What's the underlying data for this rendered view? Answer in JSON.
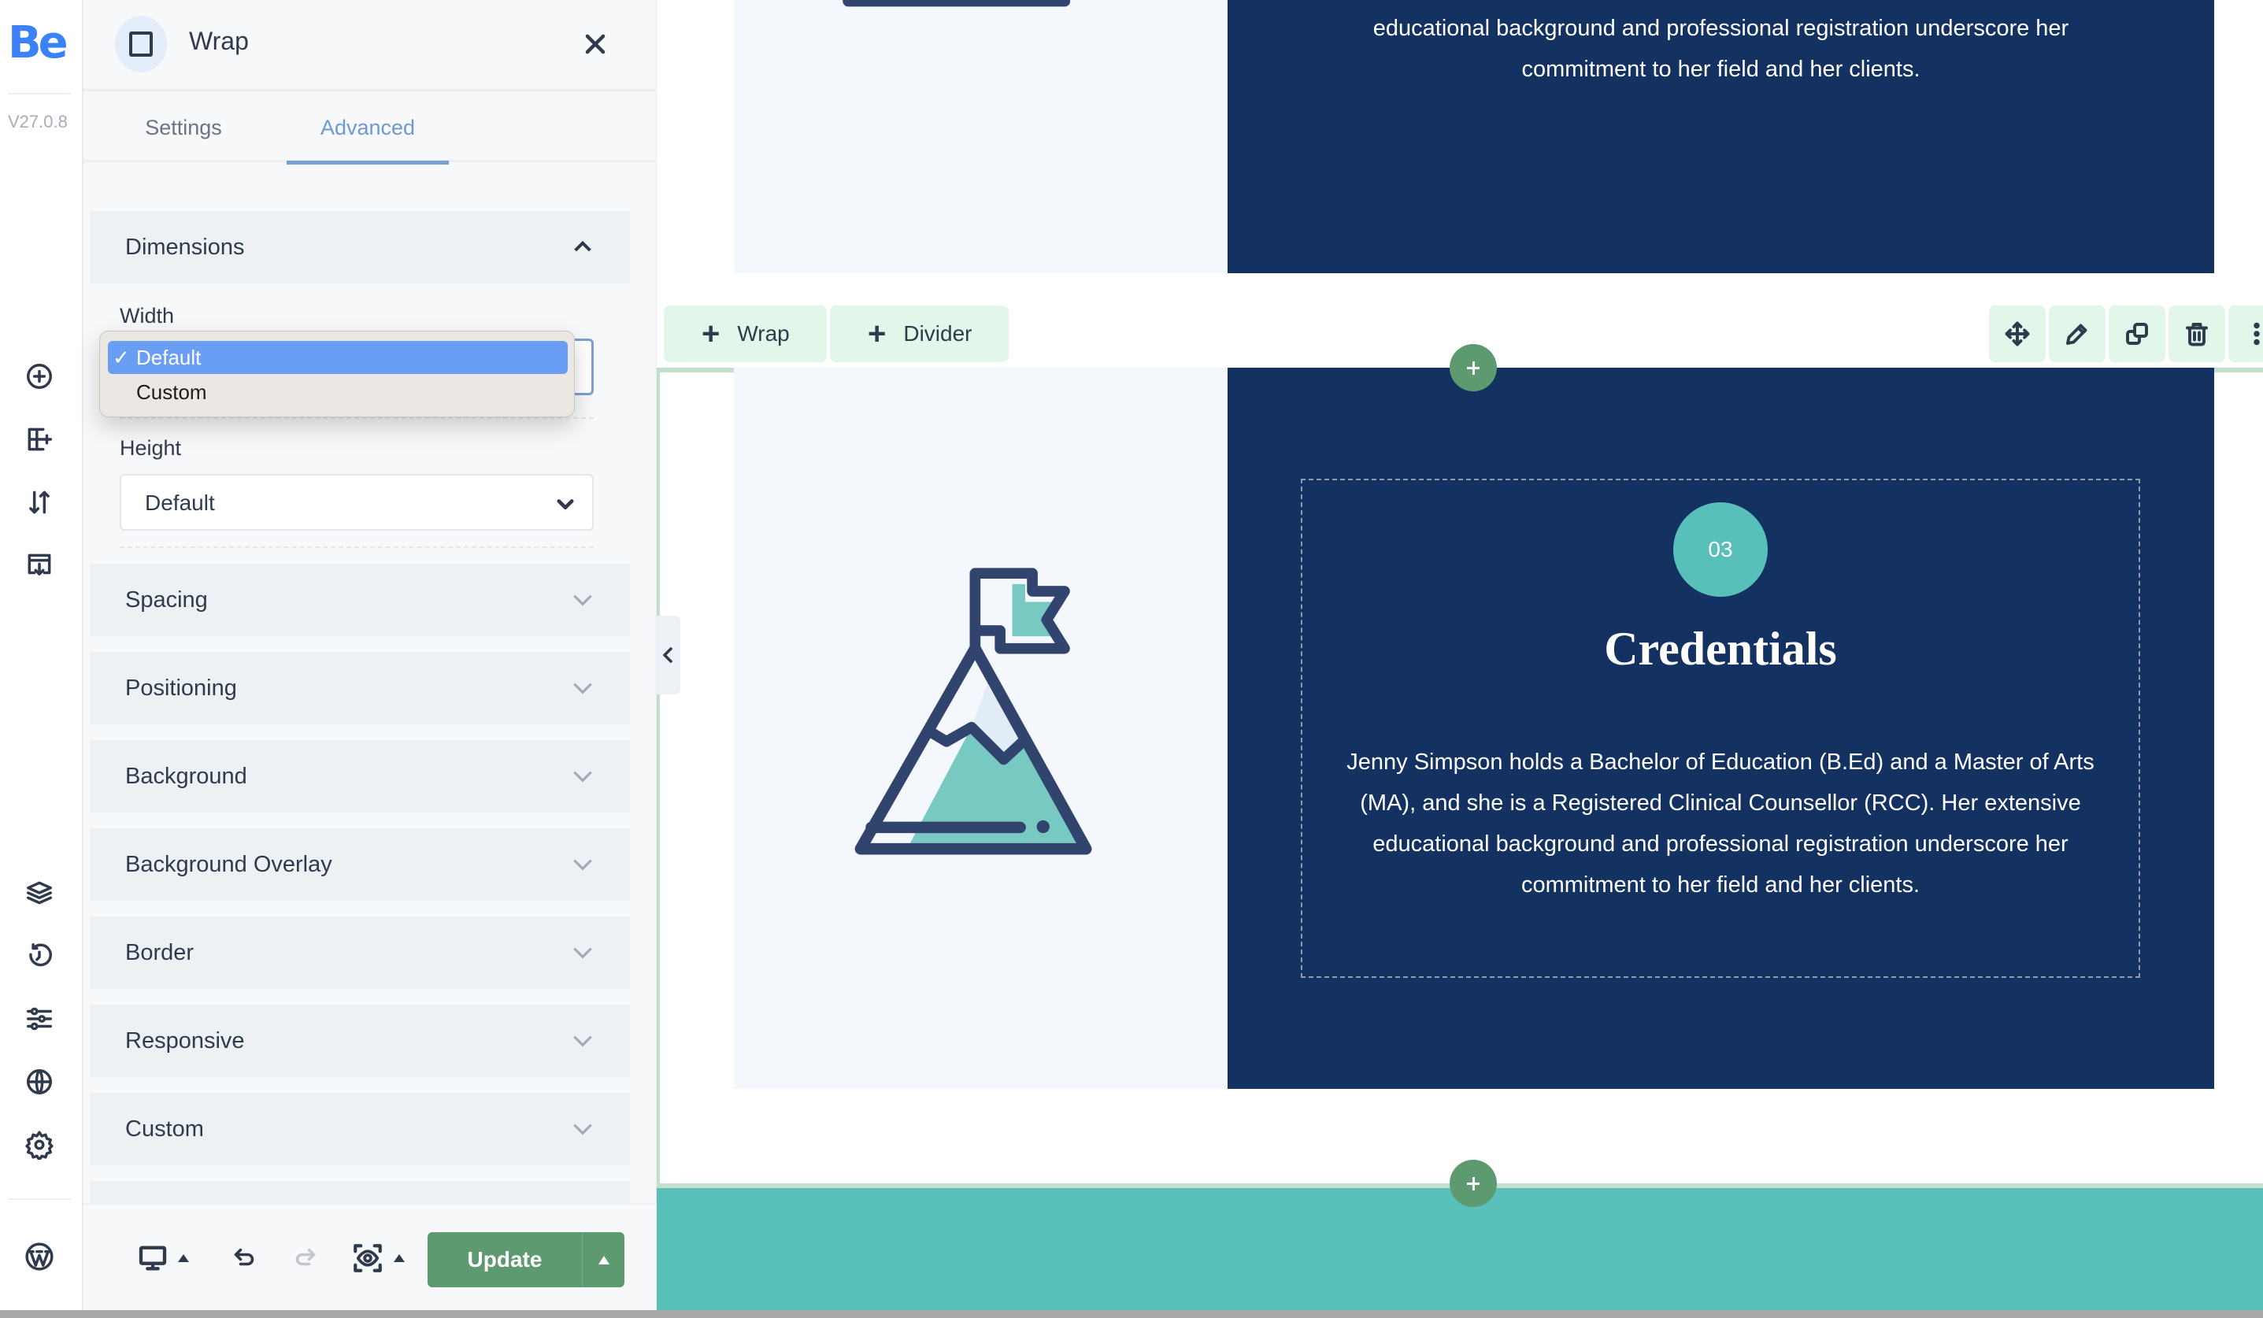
{
  "rail": {
    "logo": "Be",
    "version": "V27.0.8",
    "top_icons": [
      "add-element-icon",
      "add-wrap-icon",
      "sort-icon",
      "templates-import-icon"
    ],
    "bottom_icons": [
      "layers-icon",
      "history-icon",
      "settings-sliders-icon",
      "globe-icon",
      "gear-icon"
    ],
    "footer_icon": "wordpress-icon"
  },
  "panel": {
    "element_icon": "wrap-square-icon",
    "title": "Wrap",
    "close_icon": "close-icon",
    "tabs": [
      {
        "label": "Settings",
        "active": false
      },
      {
        "label": "Advanced",
        "active": true
      }
    ],
    "dimensions": {
      "label": "Dimensions",
      "expanded": true,
      "width": {
        "label": "Width",
        "value": "Default",
        "options": [
          {
            "label": "Default",
            "selected": true
          },
          {
            "label": "Custom",
            "selected": false
          }
        ],
        "checkmark": "✓"
      },
      "height": {
        "label": "Height",
        "value": "Default"
      }
    },
    "sections": [
      {
        "label": "Spacing"
      },
      {
        "label": "Positioning"
      },
      {
        "label": "Background"
      },
      {
        "label": "Background Overlay"
      },
      {
        "label": "Border"
      },
      {
        "label": "Responsive"
      },
      {
        "label": "Custom"
      }
    ],
    "toolbar": {
      "device_icon": "desktop-icon",
      "undo_icon": "undo-icon",
      "redo_icon": "redo-icon",
      "preview_icon": "preview-eye-icon",
      "update_label": "Update"
    }
  },
  "canvas": {
    "top_paragraph_lines": [
      "educational background and professional registration underscore her",
      "commitment to her field and her clients."
    ],
    "add_buttons": [
      {
        "label": "Wrap"
      },
      {
        "label": "Divider"
      }
    ],
    "action_icons": [
      "move-icon",
      "edit-pencil-icon",
      "duplicate-icon",
      "trash-icon",
      "more-vertical-icon"
    ],
    "card": {
      "number": "03",
      "title": "Credentials",
      "paragraph": "Jenny Simpson holds a Bachelor of Education (B.Ed) and a Master of Arts (MA), and she is a Registered Clinical Counsellor (RCC). Her extensive educational background and professional registration underscore her commitment to her field and her clients."
    },
    "colors": {
      "navy": "#143261",
      "teal": "#58bfb9",
      "accent_green": "#5e9a70",
      "brand_blue": "#3b82f6"
    }
  }
}
